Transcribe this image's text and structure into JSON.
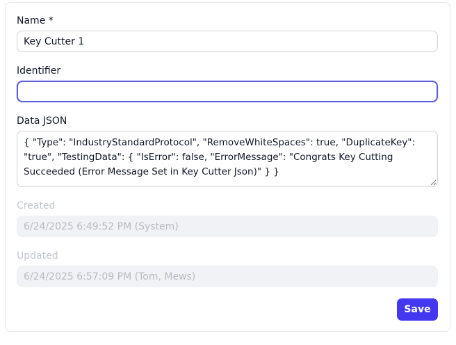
{
  "form": {
    "name_label": "Name *",
    "name_value": "Key Cutter 1",
    "identifier_label": "Identifier",
    "identifier_value": "",
    "data_json_label": "Data JSON",
    "data_json_value": "{ \"Type\": \"IndustryStandardProtocol\", \"RemoveWhiteSpaces\": true, \"DuplicateKey\":\n\"true\", \"TestingData\": { \"IsError\": false, \"ErrorMessage\": \"Congrats Key Cutting\nSucceeded (Error Message Set in Key Cutter Json)\" } }",
    "created_label": "Created",
    "created_value": "6/24/2025 6:49:52 PM (System)",
    "updated_label": "Updated",
    "updated_value": "6/24/2025 6:57:09 PM (Tom, Mews)",
    "save_label": "Save"
  },
  "colors": {
    "accent": "#4338f0",
    "focus_border": "#5b5fe0",
    "disabled_bg": "#f1f2f6",
    "muted_text": "#c2c6cd"
  }
}
